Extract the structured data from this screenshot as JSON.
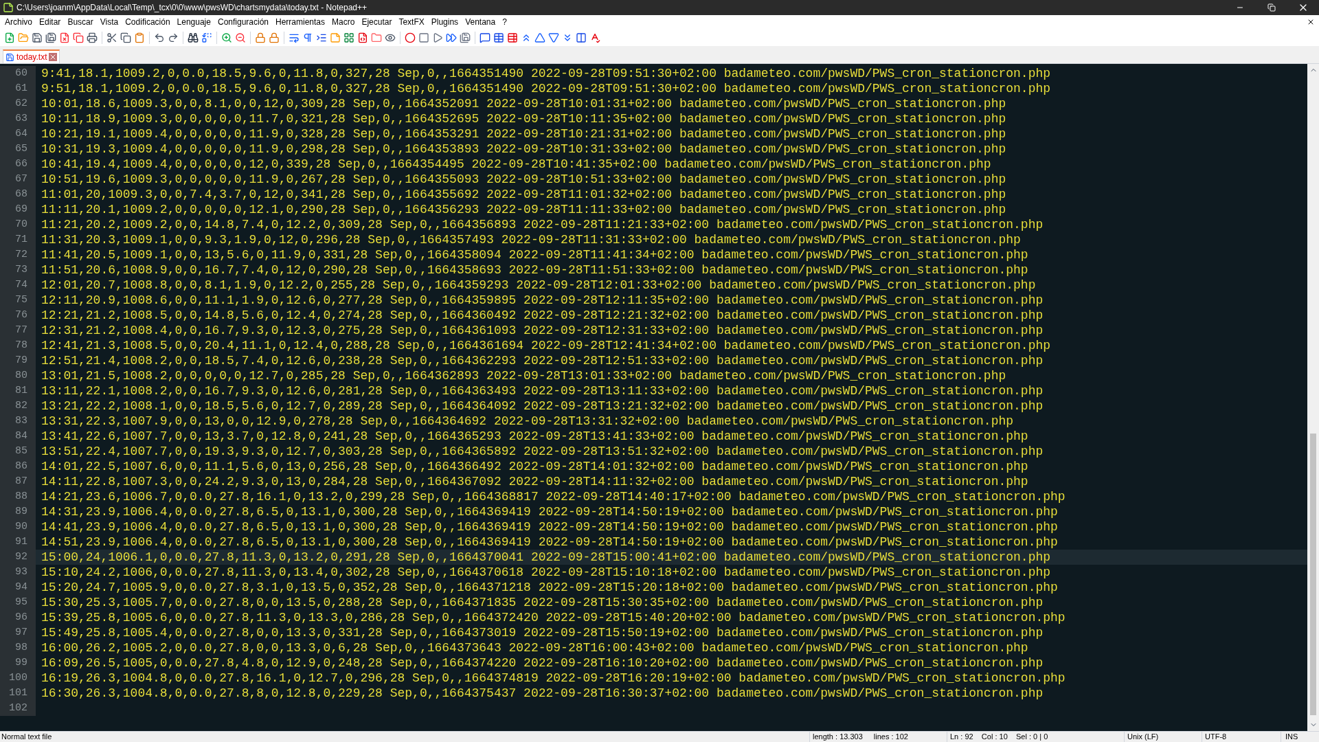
{
  "window": {
    "title": "C:\\Users\\joanm\\AppData\\Local\\Temp\\_tcx\\0\\0\\www\\pwsWD\\chartsmydata\\today.txt - Notepad++"
  },
  "menu": [
    "Archivo",
    "Editar",
    "Buscar",
    "Vista",
    "Codificación",
    "Lenguaje",
    "Configuración",
    "Herramientas",
    "Macro",
    "Ejecutar",
    "TextFX",
    "Plugins",
    "Ventana",
    "?"
  ],
  "tabs": [
    {
      "label": "today.txt",
      "selected": true
    }
  ],
  "lines": [
    {
      "number": "60",
      "text": "9:41,18.1,1009.2,0,0.0,18.5,9.6,0,11.8,0,327,28 Sep,0,,1664351490 2022-09-28T09:51:30+02:00 badameteo.com/pwsWD/PWS_cron_stationcron.php",
      "current": false
    },
    {
      "number": "61",
      "text": "9:51,18.1,1009.2,0,0.0,18.5,9.6,0,11.8,0,327,28 Sep,0,,1664351490 2022-09-28T09:51:30+02:00 badameteo.com/pwsWD/PWS_cron_stationcron.php",
      "current": false
    },
    {
      "number": "62",
      "text": "10:01,18.6,1009.3,0,0,8.1,0,0,12,0,309,28 Sep,0,,1664352091 2022-09-28T10:01:31+02:00 badameteo.com/pwsWD/PWS_cron_stationcron.php",
      "current": false
    },
    {
      "number": "63",
      "text": "10:11,18.9,1009.3,0,0,0,0,0,11.7,0,321,28 Sep,0,,1664352695 2022-09-28T10:11:35+02:00 badameteo.com/pwsWD/PWS_cron_stationcron.php",
      "current": false
    },
    {
      "number": "64",
      "text": "10:21,19.1,1009.4,0,0,0,0,0,11.9,0,328,28 Sep,0,,1664353291 2022-09-28T10:21:31+02:00 badameteo.com/pwsWD/PWS_cron_stationcron.php",
      "current": false
    },
    {
      "number": "65",
      "text": "10:31,19.3,1009.4,0,0,0,0,0,11.9,0,298,28 Sep,0,,1664353893 2022-09-28T10:31:33+02:00 badameteo.com/pwsWD/PWS_cron_stationcron.php",
      "current": false
    },
    {
      "number": "66",
      "text": "10:41,19.4,1009.4,0,0,0,0,0,12,0,339,28 Sep,0,,1664354495 2022-09-28T10:41:35+02:00 badameteo.com/pwsWD/PWS_cron_stationcron.php",
      "current": false
    },
    {
      "number": "67",
      "text": "10:51,19.6,1009.3,0,0,0,0,0,11.9,0,267,28 Sep,0,,1664355093 2022-09-28T10:51:33+02:00 badameteo.com/pwsWD/PWS_cron_stationcron.php",
      "current": false
    },
    {
      "number": "68",
      "text": "11:01,20,1009.3,0,0,7.4,3.7,0,12,0,341,28 Sep,0,,1664355692 2022-09-28T11:01:32+02:00 badameteo.com/pwsWD/PWS_cron_stationcron.php",
      "current": false
    },
    {
      "number": "69",
      "text": "11:11,20.1,1009.2,0,0,0,0,0,12.1,0,290,28 Sep,0,,1664356293 2022-09-28T11:11:33+02:00 badameteo.com/pwsWD/PWS_cron_stationcron.php",
      "current": false
    },
    {
      "number": "70",
      "text": "11:21,20.2,1009.2,0,0,14.8,7.4,0,12.2,0,309,28 Sep,0,,1664356893 2022-09-28T11:21:33+02:00 badameteo.com/pwsWD/PWS_cron_stationcron.php",
      "current": false
    },
    {
      "number": "71",
      "text": "11:31,20.3,1009.1,0,0,9.3,1.9,0,12,0,296,28 Sep,0,,1664357493 2022-09-28T11:31:33+02:00 badameteo.com/pwsWD/PWS_cron_stationcron.php",
      "current": false
    },
    {
      "number": "72",
      "text": "11:41,20.5,1009.1,0,0,13,5.6,0,11.9,0,331,28 Sep,0,,1664358094 2022-09-28T11:41:34+02:00 badameteo.com/pwsWD/PWS_cron_stationcron.php",
      "current": false
    },
    {
      "number": "73",
      "text": "11:51,20.6,1008.9,0,0,16.7,7.4,0,12,0,290,28 Sep,0,,1664358693 2022-09-28T11:51:33+02:00 badameteo.com/pwsWD/PWS_cron_stationcron.php",
      "current": false
    },
    {
      "number": "74",
      "text": "12:01,20.7,1008.8,0,0,8.1,1.9,0,12.2,0,255,28 Sep,0,,1664359293 2022-09-28T12:01:33+02:00 badameteo.com/pwsWD/PWS_cron_stationcron.php",
      "current": false
    },
    {
      "number": "75",
      "text": "12:11,20.9,1008.6,0,0,11.1,1.9,0,12.6,0,277,28 Sep,0,,1664359895 2022-09-28T12:11:35+02:00 badameteo.com/pwsWD/PWS_cron_stationcron.php",
      "current": false
    },
    {
      "number": "76",
      "text": "12:21,21.2,1008.5,0,0,14.8,5.6,0,12.4,0,274,28 Sep,0,,1664360492 2022-09-28T12:21:32+02:00 badameteo.com/pwsWD/PWS_cron_stationcron.php",
      "current": false
    },
    {
      "number": "77",
      "text": "12:31,21.2,1008.4,0,0,16.7,9.3,0,12.3,0,275,28 Sep,0,,1664361093 2022-09-28T12:31:33+02:00 badameteo.com/pwsWD/PWS_cron_stationcron.php",
      "current": false
    },
    {
      "number": "78",
      "text": "12:41,21.3,1008.5,0,0,20.4,11.1,0,12.4,0,288,28 Sep,0,,1664361694 2022-09-28T12:41:34+02:00 badameteo.com/pwsWD/PWS_cron_stationcron.php",
      "current": false
    },
    {
      "number": "79",
      "text": "12:51,21.4,1008.2,0,0,18.5,7.4,0,12.6,0,238,28 Sep,0,,1664362293 2022-09-28T12:51:33+02:00 badameteo.com/pwsWD/PWS_cron_stationcron.php",
      "current": false
    },
    {
      "number": "80",
      "text": "13:01,21.5,1008.2,0,0,0,0,0,12.7,0,285,28 Sep,0,,1664362893 2022-09-28T13:01:33+02:00 badameteo.com/pwsWD/PWS_cron_stationcron.php",
      "current": false
    },
    {
      "number": "81",
      "text": "13:11,22.1,1008.2,0,0,16.7,9.3,0,12.6,0,281,28 Sep,0,,1664363493 2022-09-28T13:11:33+02:00 badameteo.com/pwsWD/PWS_cron_stationcron.php",
      "current": false
    },
    {
      "number": "82",
      "text": "13:21,22.2,1008.1,0,0,18.5,5.6,0,12.7,0,289,28 Sep,0,,1664364092 2022-09-28T13:21:32+02:00 badameteo.com/pwsWD/PWS_cron_stationcron.php",
      "current": false
    },
    {
      "number": "83",
      "text": "13:31,22.3,1007.9,0,0,13,0,0,12.9,0,278,28 Sep,0,,1664364692 2022-09-28T13:31:32+02:00 badameteo.com/pwsWD/PWS_cron_stationcron.php",
      "current": false
    },
    {
      "number": "84",
      "text": "13:41,22.6,1007.7,0,0,13,3.7,0,12.8,0,241,28 Sep,0,,1664365293 2022-09-28T13:41:33+02:00 badameteo.com/pwsWD/PWS_cron_stationcron.php",
      "current": false
    },
    {
      "number": "85",
      "text": "13:51,22.4,1007.7,0,0,19.3,9.3,0,12.7,0,303,28 Sep,0,,1664365892 2022-09-28T13:51:32+02:00 badameteo.com/pwsWD/PWS_cron_stationcron.php",
      "current": false
    },
    {
      "number": "86",
      "text": "14:01,22.5,1007.6,0,0,11.1,5.6,0,13,0,256,28 Sep,0,,1664366492 2022-09-28T14:01:32+02:00 badameteo.com/pwsWD/PWS_cron_stationcron.php",
      "current": false
    },
    {
      "number": "87",
      "text": "14:11,22.8,1007.3,0,0,24.2,9.3,0,13,0,284,28 Sep,0,,1664367092 2022-09-28T14:11:32+02:00 badameteo.com/pwsWD/PWS_cron_stationcron.php",
      "current": false
    },
    {
      "number": "88",
      "text": "14:21,23.6,1006.7,0,0.0,27.8,16.1,0,13.2,0,299,28 Sep,0,,1664368817 2022-09-28T14:40:17+02:00 badameteo.com/pwsWD/PWS_cron_stationcron.php",
      "current": false
    },
    {
      "number": "89",
      "text": "14:31,23.9,1006.4,0,0.0,27.8,6.5,0,13.1,0,300,28 Sep,0,,1664369419 2022-09-28T14:50:19+02:00 badameteo.com/pwsWD/PWS_cron_stationcron.php",
      "current": false
    },
    {
      "number": "90",
      "text": "14:41,23.9,1006.4,0,0.0,27.8,6.5,0,13.1,0,300,28 Sep,0,,1664369419 2022-09-28T14:50:19+02:00 badameteo.com/pwsWD/PWS_cron_stationcron.php",
      "current": false
    },
    {
      "number": "91",
      "text": "14:51,23.9,1006.4,0,0.0,27.8,6.5,0,13.1,0,300,28 Sep,0,,1664369419 2022-09-28T14:50:19+02:00 badameteo.com/pwsWD/PWS_cron_stationcron.php",
      "current": false
    },
    {
      "number": "92",
      "text": "15:00,24,1006.1,0,0.0,27.8,11.3,0,13.2,0,291,28 Sep,0,,1664370041 2022-09-28T15:00:41+02:00 badameteo.com/pwsWD/PWS_cron_stationcron.php",
      "current": true
    },
    {
      "number": "93",
      "text": "15:10,24.2,1006,0,0.0,27.8,11.3,0,13.4,0,302,28 Sep,0,,1664370618 2022-09-28T15:10:18+02:00 badameteo.com/pwsWD/PWS_cron_stationcron.php",
      "current": false
    },
    {
      "number": "94",
      "text": "15:20,24.7,1005.9,0,0.0,27.8,3.1,0,13.5,0,352,28 Sep,0,,1664371218 2022-09-28T15:20:18+02:00 badameteo.com/pwsWD/PWS_cron_stationcron.php",
      "current": false
    },
    {
      "number": "95",
      "text": "15:30,25.3,1005.7,0,0.0,27.8,0,0,13.5,0,288,28 Sep,0,,1664371835 2022-09-28T15:30:35+02:00 badameteo.com/pwsWD/PWS_cron_stationcron.php",
      "current": false
    },
    {
      "number": "96",
      "text": "15:39,25.8,1005.6,0,0.0,27.8,11.3,0,13.3,0,286,28 Sep,0,,1664372420 2022-09-28T15:40:20+02:00 badameteo.com/pwsWD/PWS_cron_stationcron.php",
      "current": false
    },
    {
      "number": "97",
      "text": "15:49,25.8,1005.4,0,0.0,27.8,0,0,13.3,0,331,28 Sep,0,,1664373019 2022-09-28T15:50:19+02:00 badameteo.com/pwsWD/PWS_cron_stationcron.php",
      "current": false
    },
    {
      "number": "98",
      "text": "16:00,26.2,1005.2,0,0.0,27.8,0,0,13.3,0,6,28 Sep,0,,1664373643 2022-09-28T16:00:43+02:00 badameteo.com/pwsWD/PWS_cron_stationcron.php",
      "current": false
    },
    {
      "number": "99",
      "text": "16:09,26.5,1005,0,0.0,27.8,4.8,0,12.9,0,248,28 Sep,0,,1664374220 2022-09-28T16:10:20+02:00 badameteo.com/pwsWD/PWS_cron_stationcron.php",
      "current": false
    },
    {
      "number": "100",
      "text": "16:19,26.3,1004.8,0,0.0,27.8,16.1,0,12.7,0,296,28 Sep,0,,1664374819 2022-09-28T16:20:19+02:00 badameteo.com/pwsWD/PWS_cron_stationcron.php",
      "current": false
    },
    {
      "number": "101",
      "text": "16:30,26.3,1004.8,0,0.0,27.8,8,0,12.8,0,229,28 Sep,0,,1664375437 2022-09-28T16:30:37+02:00 badameteo.com/pwsWD/PWS_cron_stationcron.php",
      "current": false
    },
    {
      "number": "102",
      "current": false
    }
  ],
  "status_bar": {
    "file_type": "Normal text file",
    "length": "length : 13.303",
    "lines": "lines : 102",
    "position": "Ln : 92    Col : 10    Sel : 0 | 0",
    "eol": "Unix (LF)",
    "encoding": "UTF-8",
    "mode": "INS"
  }
}
